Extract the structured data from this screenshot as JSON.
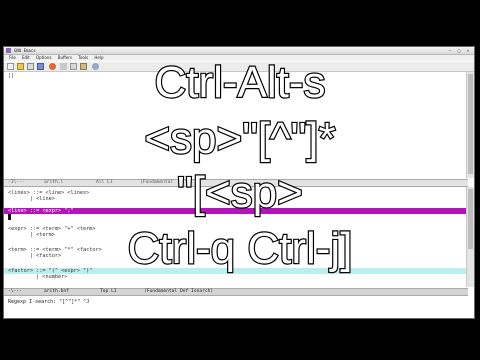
{
  "window": {
    "title": "GNU Emacs",
    "menu": [
      "File",
      "Edit",
      "Options",
      "Buffers",
      "Tools",
      "Help"
    ],
    "buttons": [
      "–",
      "□",
      "×"
    ]
  },
  "top_pane": {
    "prompt_line": "||"
  },
  "modeline_top": {
    "status": "-1\\---",
    "buffer": "arith.l",
    "position": "All L1",
    "mode": "(Fundamental"
  },
  "bottom_pane": {
    "lines": [
      "<lines> ::= <line> <lines>",
      "       | <line>",
      "",
      "<line> ::= <expr> \";\"",
      "",
      "<expr> ::= <term> \"+\" <term>",
      "       | <term>",
      "",
      "<term> ::= <term> \"*\" <factor>",
      "       | <factor>",
      "",
      "<factor> ::= \"(\" <expr> \")\"",
      "         | <number>"
    ]
  },
  "modeline_bottom": {
    "status": "-\\---",
    "buffer": "arith.bnf",
    "position": "Top L1",
    "mode": "(Fundamental Def Isearch)"
  },
  "minibuffer": {
    "text": "Regexp I-search: \"[^\"]*\" ^J"
  },
  "overlay": {
    "line1": "Ctrl-Alt-s",
    "line2": "<sp>\"[^\"]*",
    "line3": "\"[<sp>",
    "line4": "Ctrl-q Ctrl-j]"
  },
  "colors": {
    "highlight_match": "#b015b8",
    "highlight_secondary": "#bdeeee",
    "background": "#000000"
  }
}
